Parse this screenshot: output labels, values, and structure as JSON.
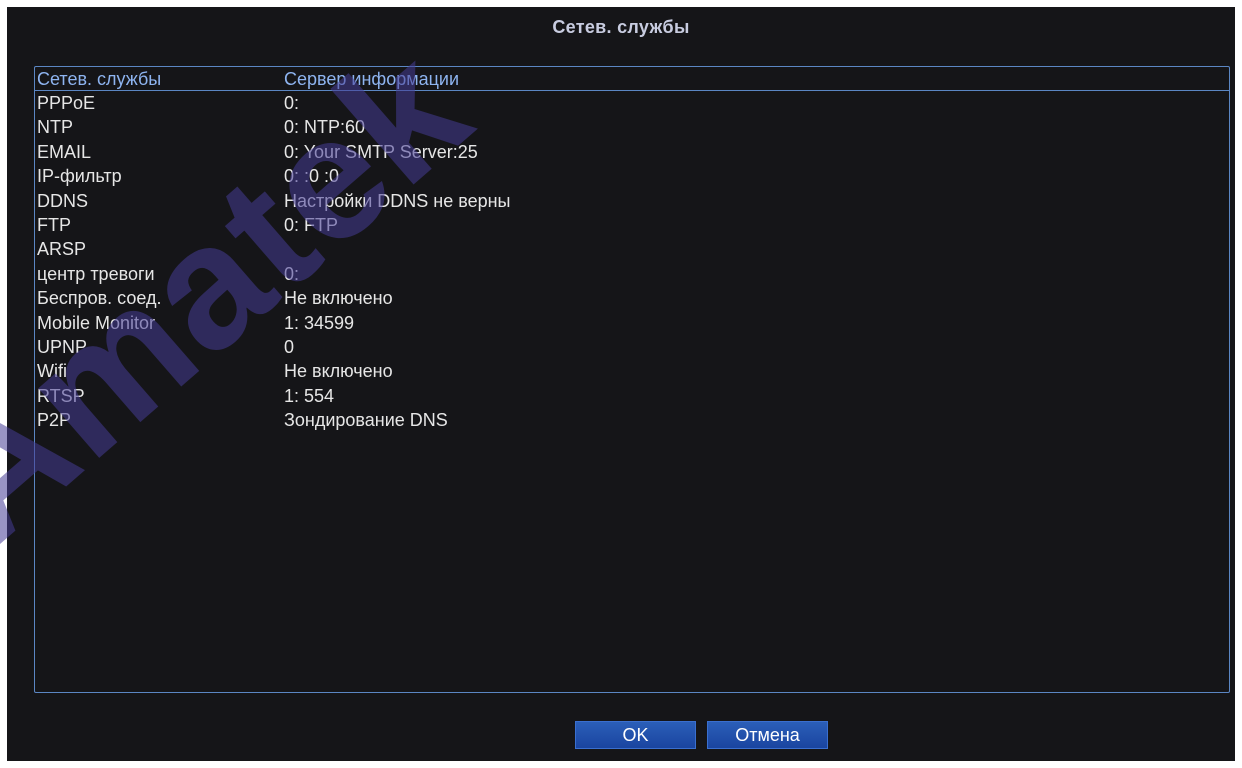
{
  "window": {
    "title": "Сетев. службы"
  },
  "table": {
    "headers": [
      "Сетев. службы",
      "Сервер информации"
    ],
    "rows": [
      {
        "service": "PPPoE",
        "info": "0:"
      },
      {
        "service": "NTP",
        "info": "0: NTP:60"
      },
      {
        "service": "EMAIL",
        "info": "0: Your SMTP Server:25"
      },
      {
        "service": "IP-фильтр",
        "info": "0: :0 :0"
      },
      {
        "service": "DDNS",
        "info": "Настройки DDNS не верны"
      },
      {
        "service": "FTP",
        "info": "0: FTP"
      },
      {
        "service": "ARSP",
        "info": ""
      },
      {
        "service": "центр тревоги",
        "info": "0:"
      },
      {
        "service": "Беспров. соед.",
        "info": "Не включено"
      },
      {
        "service": "Mobile Monitor",
        "info": "1: 34599"
      },
      {
        "service": "UPNP",
        "info": "0"
      },
      {
        "service": "Wifi",
        "info": "Не включено"
      },
      {
        "service": "RTSP",
        "info": "1: 554"
      },
      {
        "service": "P2P",
        "info": "Зондирование DNS"
      }
    ]
  },
  "buttons": {
    "ok": "OK",
    "cancel": "Отмена"
  },
  "watermark": {
    "text": "Amatek"
  },
  "colors": {
    "background": "#151518",
    "header_text": "#8eb4f0",
    "border": "#5b86c3",
    "button": "#2553ad",
    "text": "#e6e6e6"
  }
}
